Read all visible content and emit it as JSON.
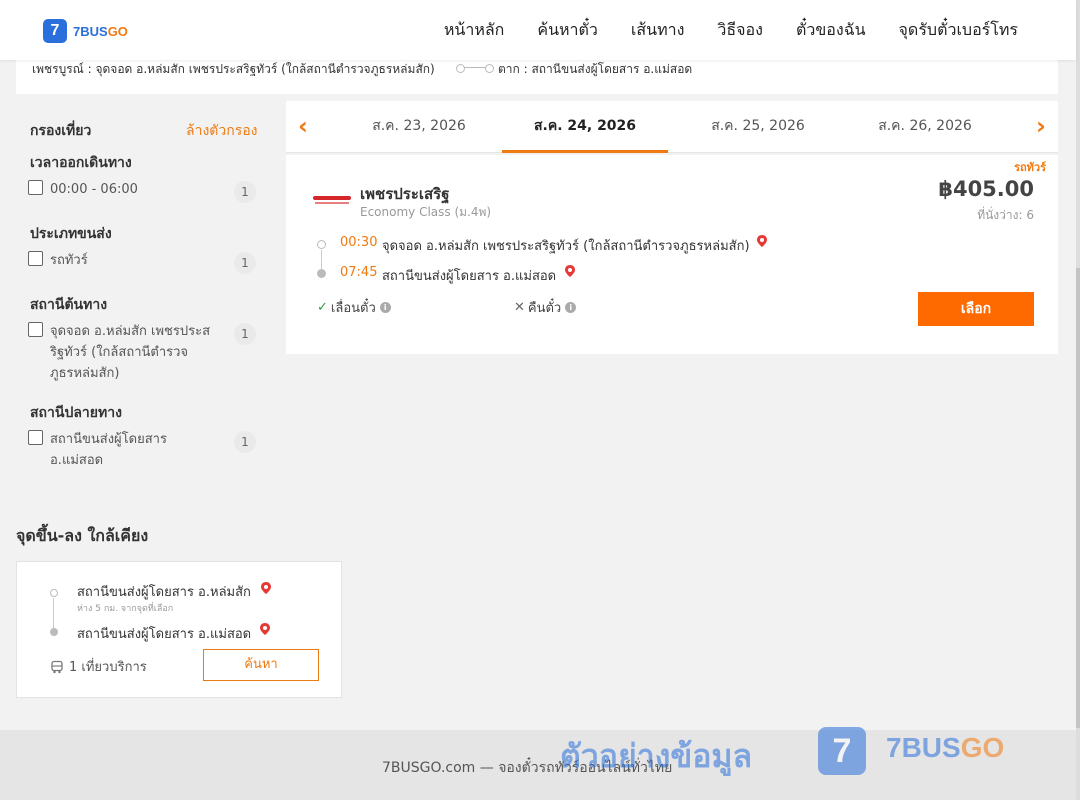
{
  "brand": {
    "badge": "7",
    "name_part1": "7BUS",
    "name_part2": "GO"
  },
  "nav": [
    "หน้าหลัก",
    "ค้นหาตั๋ว",
    "เส้นทาง",
    "วิธีจอง",
    "ตั๋วของฉัน",
    "จุดรับตั๋วเบอร์โทร"
  ],
  "route": {
    "origin": "เพชรบูรณ์ : จุดจอด อ.หล่มสัก เพชรประสริฐทัวร์ (ใกล้สถานีตำรวจภูธรหล่มสัก)",
    "destination": "ตาก : สถานีขนส่งผู้โดยสาร อ.แม่สอด"
  },
  "filters": {
    "title": "กรองเที่ยว",
    "clear": "ล้างตัวกรอง",
    "sections": [
      {
        "title": "เวลาออกเดินทาง",
        "option": "00:00 - 06:00",
        "count": "1"
      },
      {
        "title": "ประเภทขนส่ง",
        "option": "รถทัวร์",
        "count": "1"
      },
      {
        "title": "สถานีต้นทาง",
        "option": "จุดจอด อ.หล่มสัก เพชรประสริฐทัวร์ (ใกล้สถานีตำรวจภูธรหล่มสัก)",
        "count": "1"
      },
      {
        "title": "สถานีปลายทาง",
        "option": "สถานีขนส่งผู้โดยสาร อ.แม่สอด",
        "count": "1"
      }
    ]
  },
  "dates": {
    "tabs": [
      "ส.ค. 23, 2026",
      "ส.ค. 24, 2026",
      "ส.ค. 25, 2026",
      "ส.ค. 26, 2026"
    ],
    "active_index": 1,
    "prev": "‹",
    "next": "›"
  },
  "trip": {
    "badge": "รถทัวร์",
    "operator": "เพชรประเสริฐ",
    "class": "Economy Class (ม.4พ)",
    "price": "฿405.00",
    "seats": "ที่นั่งว่าง: 6",
    "depart_time": "00:30",
    "depart_stop": "จุดจอด อ.หล่มสัก เพชรประสริฐทัวร์ (ใกล้สถานีตำรวจภูธรหล่มสัก)",
    "arrive_time": "07:45",
    "arrive_stop": "สถานีขนส่งผู้โดยสาร อ.แม่สอด",
    "feature_reschedule": "เลื่อนตั๋ว",
    "feature_refund": "คืนตั๋ว",
    "select_label": "เลือก"
  },
  "nearby": {
    "title": "จุดขึ้น-ลง ใกล้เคียง",
    "from_stop": "สถานีขนส่งผู้โดยสาร อ.หล่มสัก",
    "distance": "ห่าง 5 กม. จากจุดที่เลือก",
    "to_stop": "สถานีขนส่งผู้โดยสาร อ.แม่สอด",
    "trips": "1 เที่ยวบริการ",
    "search_label": "ค้นหา"
  },
  "footer": {
    "text": "7BUSGO.com — จองตั๋วรถทัวร์ออนไลน์ทั่วไทย"
  },
  "watermark": {
    "text": "ตัวอย่างข้อมูล",
    "badge": "7",
    "brand_part1": "7BUS",
    "brand_part2": "GO"
  },
  "colors": {
    "accent": "#f07a12",
    "primary": "#2a6fdb",
    "button": "#ff6a00",
    "pin": "#e53935"
  }
}
